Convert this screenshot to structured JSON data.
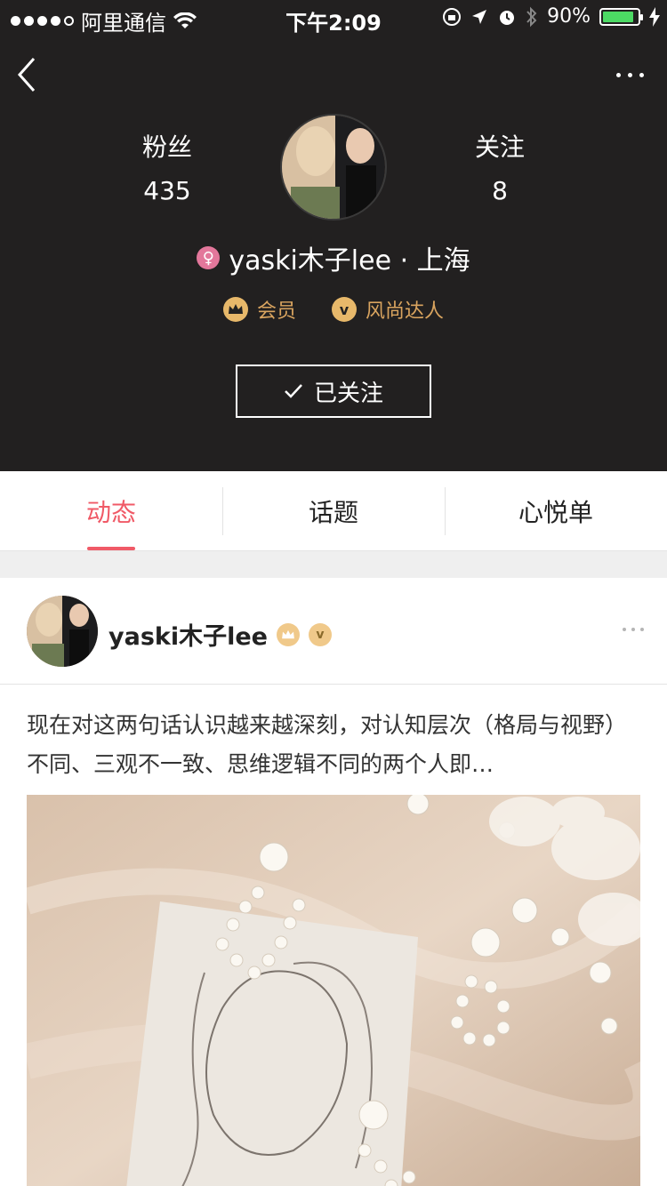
{
  "status_bar": {
    "carrier": "阿里通信",
    "time": "下午2:09",
    "battery": "90%",
    "battery_level": 0.9
  },
  "profile": {
    "fans_label": "粉丝",
    "fans_count": "435",
    "follow_label": "关注",
    "follow_count": "8",
    "name_location": "yaski木子lee · 上海",
    "gender_symbol": "♀",
    "badge_member": "会员",
    "badge_fashion": "风尚达人",
    "badge_fashion_icon": "v",
    "follow_button": "已关注"
  },
  "tabs": [
    {
      "label": "动态",
      "active": true
    },
    {
      "label": "话题",
      "active": false
    },
    {
      "label": "心悦单",
      "active": false
    }
  ],
  "post": {
    "username": "yaski木子lee",
    "text": "现在对这两句话认识越来越深刻，对认知层次（格局与视野）不同、三观不一致、思维逻辑不同的两个人即…"
  },
  "colors": {
    "header_bg": "#222020",
    "accent_pink": "#f05a67",
    "badge_gold": "#d9a45f",
    "gender_pink": "#e3779b"
  }
}
